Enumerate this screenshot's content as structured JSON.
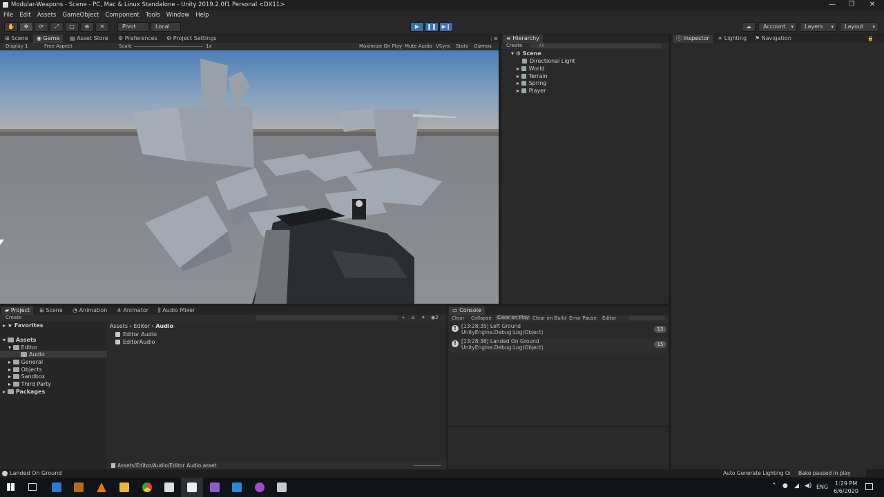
{
  "window": {
    "title": "Modular-Weapons - Scene - PC, Mac & Linux Standalone - Unity 2019.2.0f1 Personal <DX11>",
    "minimize": "—",
    "maximize": "❐",
    "close": "✕"
  },
  "menu": [
    "File",
    "Edit",
    "Assets",
    "GameObject",
    "Component",
    "Tools",
    "Window",
    "Help"
  ],
  "toolbar": {
    "pivot": "Pivot",
    "local": "Local",
    "account": "Account",
    "layers": "Layers",
    "layout": "Layout"
  },
  "topTabs": {
    "scene": "Scene",
    "game": "Game",
    "assetStore": "Asset Store",
    "preferences": "Preferences",
    "projectSettings": "Project Settings"
  },
  "gameBar": {
    "display": "Display 1",
    "aspect": "Free Aspect",
    "scale": "Scale",
    "scaleValue": "1x",
    "maximize": "Maximize On Play",
    "mute": "Mute Audio",
    "vsync": "VSync",
    "stats": "Stats",
    "gizmos": "Gizmos"
  },
  "hierarchy": {
    "tab": "Hierarchy",
    "create": "Create",
    "search": "All",
    "scene": "Scene",
    "items": [
      "Directional Light",
      "World",
      "Terrain",
      "Spring",
      "Player"
    ]
  },
  "inspectorTabs": {
    "inspector": "Inspector",
    "lighting": "Lighting",
    "navigation": "Navigation"
  },
  "bottomTabs": {
    "project": "Project",
    "scene": "Scene",
    "animation": "Animation",
    "animator": "Animator",
    "audioMixer": "Audio Mixer"
  },
  "project": {
    "create": "Create",
    "favorites": "Favorites",
    "assets": "Assets",
    "editor": "Editor",
    "audio": "Audio",
    "folders": [
      "General",
      "Objects",
      "Sandbox",
      "Third Party"
    ],
    "packages": "Packages",
    "breadcrumb": [
      "Assets",
      "Editor",
      "Audio"
    ],
    "files": [
      "Editor Audio",
      "EditorAudio"
    ],
    "path": "Assets/Editor/Audio/Editor Audio.asset",
    "badge": "2"
  },
  "console": {
    "tab": "Console",
    "buttons": [
      "Clear",
      "Collapse",
      "Clear on Play",
      "Clear on Build",
      "Error Pause",
      "Editor"
    ],
    "logs": [
      {
        "line1": "[13:28:35] Left Ground",
        "line2": "UnityEngine.Debug:Log(Object)",
        "count": "15"
      },
      {
        "line1": "[13:28:36] Landed On Ground",
        "line2": "UnityEngine.Debug:Log(Object)",
        "count": "15"
      }
    ]
  },
  "status": {
    "message": "Landed On Ground",
    "lighting": "Auto Generate Lighting On",
    "bake": "Bake paused in play mode"
  },
  "taskbar": {
    "lang": "ENG",
    "time": "1:29 PM",
    "date": "6/6/2020"
  }
}
